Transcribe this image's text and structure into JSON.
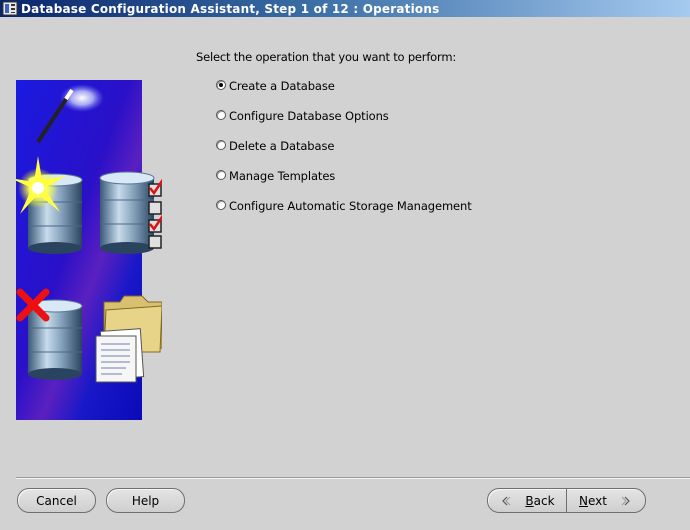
{
  "window": {
    "title": "Database Configuration Assistant, Step 1 of 12 : Operations",
    "icon": "database-app-icon"
  },
  "main": {
    "prompt": "Select the operation that you want to perform:",
    "selected_index": 0,
    "options": [
      {
        "label": "Create a Database",
        "checked": true
      },
      {
        "label": "Configure Database Options",
        "checked": false
      },
      {
        "label": "Delete a Database",
        "checked": false
      },
      {
        "label": "Manage Templates",
        "checked": false
      },
      {
        "label": "Configure Automatic Storage Management",
        "checked": false
      }
    ]
  },
  "illustration": {
    "icons": [
      "magic-wand-icon",
      "sparkle-icon",
      "database-cylinder-icon",
      "checklist-icon",
      "red-x-icon",
      "folder-documents-icon"
    ]
  },
  "footer": {
    "cancel": {
      "label": "Cancel"
    },
    "help": {
      "label": "Help"
    },
    "back": {
      "label": "Back",
      "mnemonic": "B",
      "icon": "chevron-left-icon"
    },
    "next": {
      "label": "Next",
      "mnemonic": "N",
      "icon": "chevron-right-icon"
    }
  },
  "colors": {
    "background": "#d2d2d2",
    "titlebar_start": "#0a246a",
    "titlebar_end": "#a6caf0",
    "illustration_bg": "#0000c8",
    "check_red": "#e01010"
  }
}
